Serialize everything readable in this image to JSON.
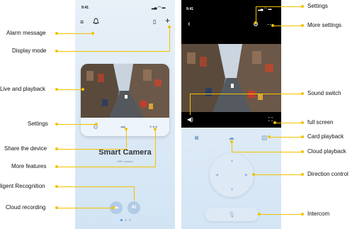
{
  "callouts_left": {
    "alarm_message": "Alarm message",
    "display_mode": "Display mode",
    "live_playback": "Live and playback",
    "settings": "Settings",
    "share_device": "Share the device",
    "more_features": "More features",
    "intelligent_recognition": "ligent Recognition",
    "cloud_recording": "Cloud recording"
  },
  "callouts_right": {
    "settings": "Settings",
    "more_settings": "More settings",
    "sound_switch": "Sound switch",
    "full_screen": "full screen",
    "card_playback": "Card playback",
    "cloud_playback": "Cloud playback",
    "direction_control": "Direction control",
    "intercom": "Intercom"
  },
  "phone1": {
    "time": "9:41",
    "camera_title": "Smart Camera",
    "camera_subtitle": "WiFi camera",
    "ai_label": "AI"
  },
  "phone2": {
    "time": "9:41"
  },
  "colors": {
    "callout": "#f2c200",
    "app_background": "#dce9f6",
    "accent_blue": "#4a90d9"
  }
}
